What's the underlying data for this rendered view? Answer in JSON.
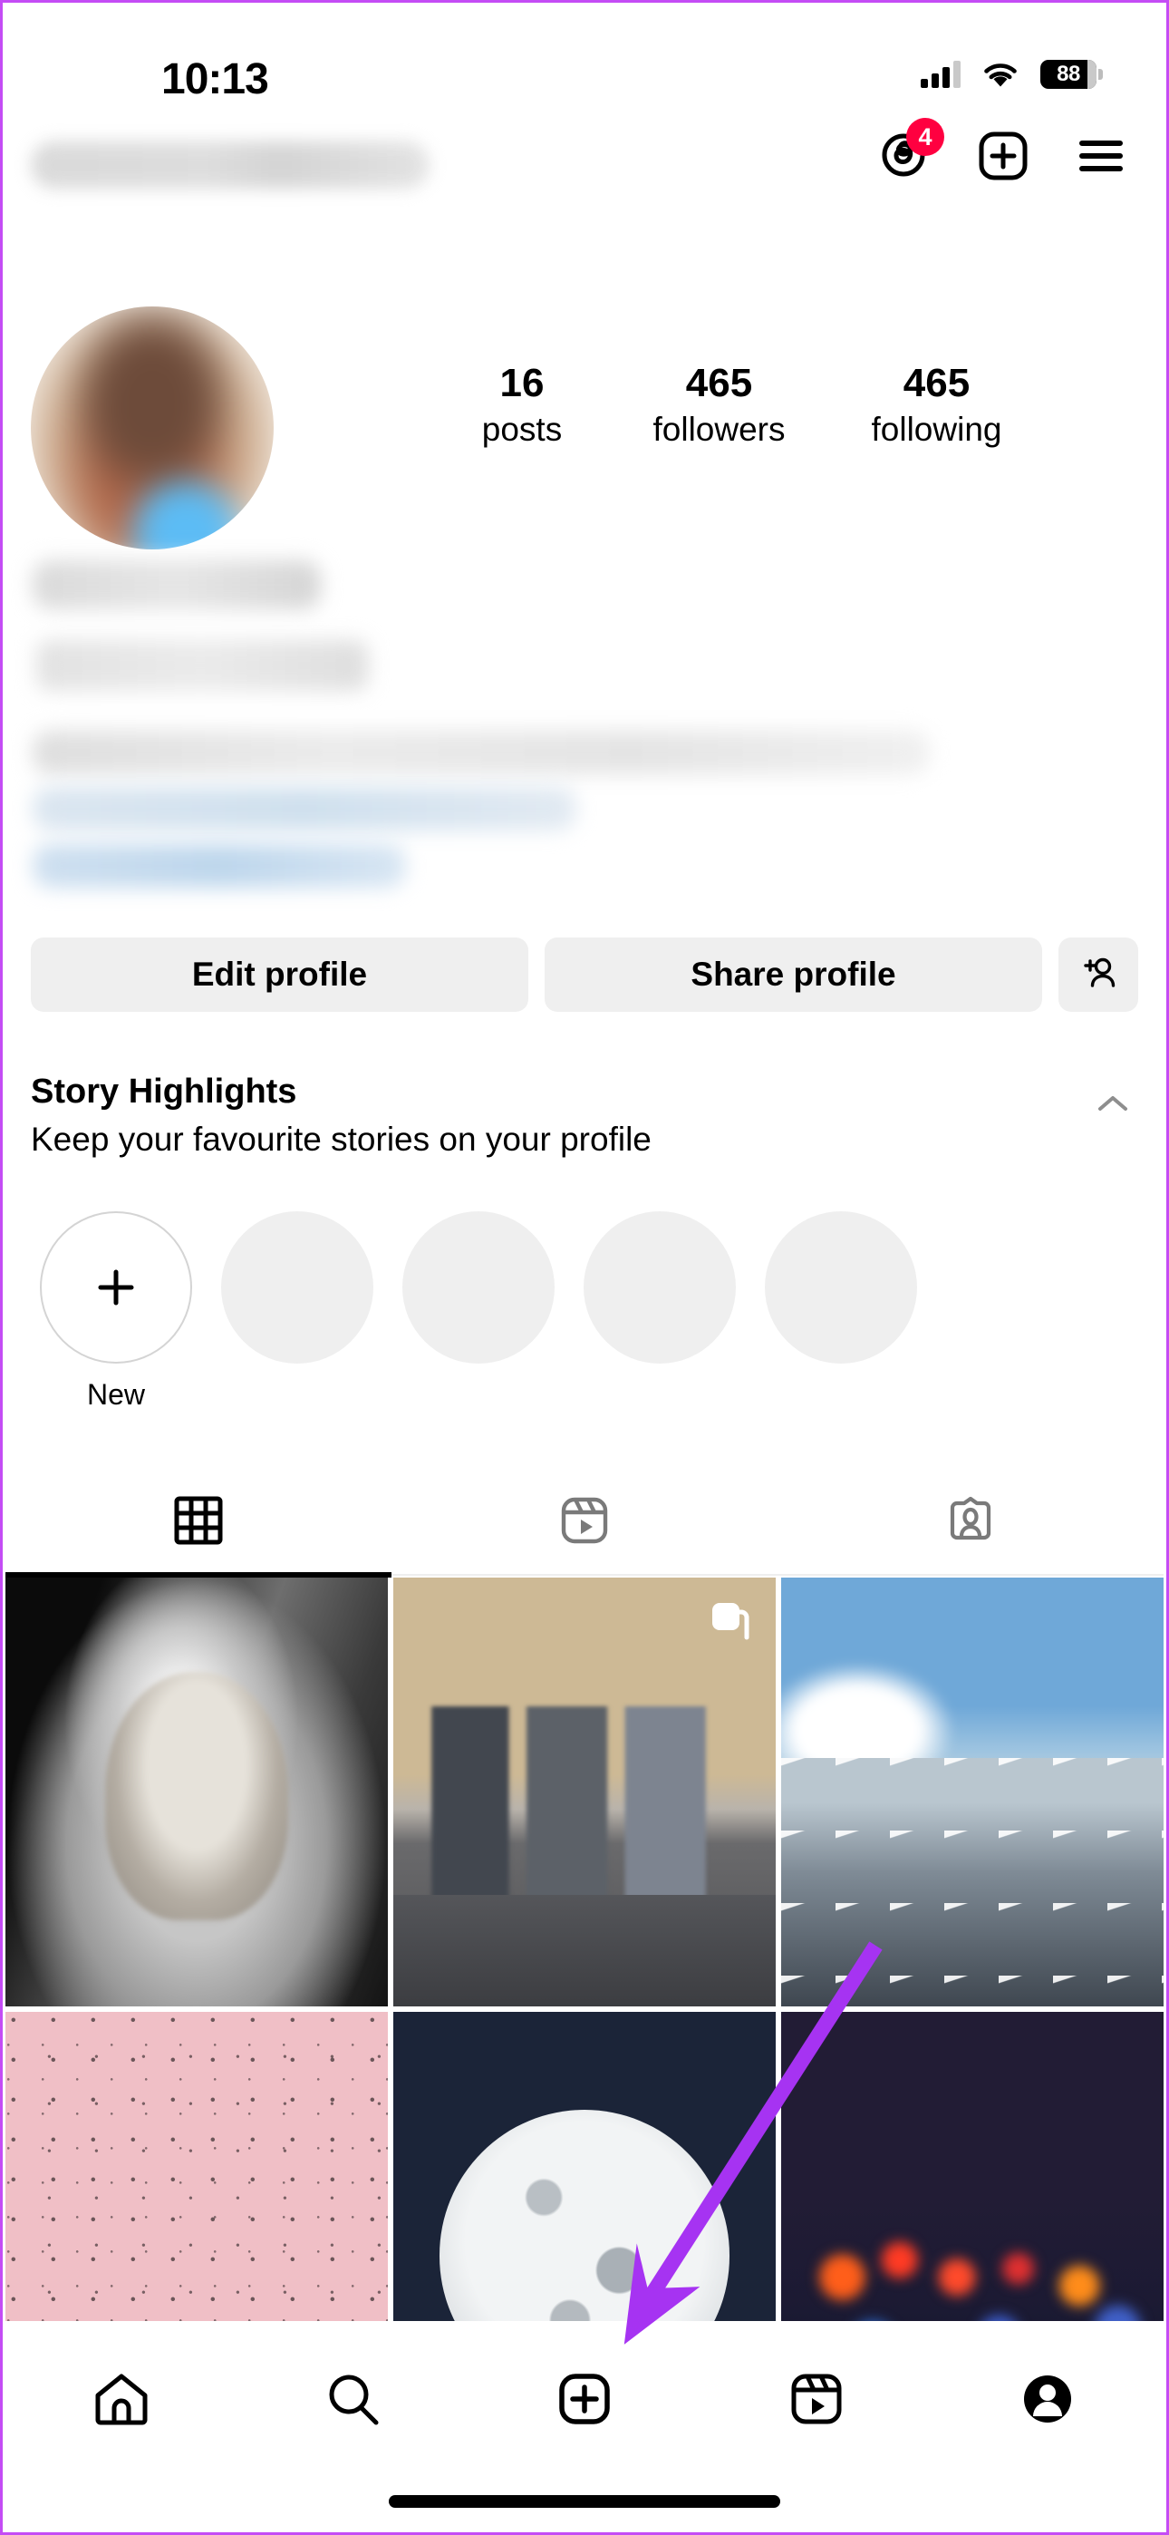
{
  "status_bar": {
    "time": "10:13",
    "battery_level": "88",
    "signal_icon": "cellular-bars-icon",
    "wifi_icon": "wifi-icon",
    "battery_icon": "battery-icon"
  },
  "header": {
    "username_redacted": true,
    "threads_icon": "threads-icon",
    "threads_badge": "4",
    "create_icon": "plus-square-icon",
    "menu_icon": "hamburger-menu-icon"
  },
  "profile": {
    "avatar": "profile-avatar-blurred",
    "name_redacted": true,
    "category_redacted": true,
    "bio_redacted": true,
    "stats": [
      {
        "count": "16",
        "label": "posts"
      },
      {
        "count": "465",
        "label": "followers"
      },
      {
        "count": "465",
        "label": "following"
      }
    ]
  },
  "actions": {
    "edit_profile": "Edit profile",
    "share_profile": "Share profile",
    "discover_people_icon": "add-person-icon"
  },
  "story_highlights": {
    "title": "Story Highlights",
    "subtitle": "Keep your favourite stories on your profile",
    "collapse_icon": "chevron-up-icon",
    "new_label": "New",
    "new_icon": "plus-icon",
    "placeholder_count": 4
  },
  "content_tabs": [
    {
      "icon": "grid-icon",
      "name": "tab-grid",
      "active": true
    },
    {
      "icon": "reels-icon",
      "name": "tab-reels",
      "active": false
    },
    {
      "icon": "tagged-icon",
      "name": "tab-tagged",
      "active": false
    }
  ],
  "posts": [
    {
      "id": "post-1",
      "description": "Black and white portrait of elderly person in shawl holding a stick",
      "art": "ph-elder",
      "carousel": false
    },
    {
      "id": "post-2",
      "description": "Three friends standing together on a mountain road",
      "art": "ph-friends",
      "carousel": true
    },
    {
      "id": "post-3",
      "description": "Snow capped mountain range under blue sky with clouds",
      "art": "ph-mountain",
      "carousel": false
    },
    {
      "id": "post-4",
      "description": "Pink window with raindrops",
      "art": "ph-rain",
      "carousel": false
    },
    {
      "id": "post-5",
      "description": "Full moon in dark navy night sky",
      "art": "ph-moon",
      "carousel": false
    },
    {
      "id": "post-6",
      "description": "Colourful bokeh city lights at night",
      "art": "ph-bokeh",
      "carousel": false
    }
  ],
  "bottom_nav": [
    {
      "icon": "home-icon",
      "name": "nav-home",
      "active": false
    },
    {
      "icon": "search-icon",
      "name": "nav-search",
      "active": false
    },
    {
      "icon": "create-icon",
      "name": "nav-create",
      "active": false
    },
    {
      "icon": "reels-icon",
      "name": "nav-reels",
      "active": false
    },
    {
      "icon": "profile-icon",
      "name": "nav-profile",
      "active": true
    }
  ],
  "annotation": {
    "arrow_color": "#a633f2",
    "points_to": "nav-create",
    "frame_color": "#c44cf5"
  }
}
